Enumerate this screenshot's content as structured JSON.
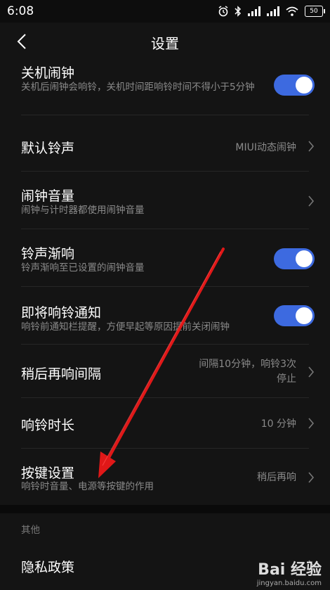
{
  "status_bar": {
    "time": "6:08",
    "battery": "50"
  },
  "header": {
    "title": "设置"
  },
  "settings": [
    {
      "label": "关机闹钟",
      "sub": "关机后闹钟会响铃，关机时间距响铃时间不得小于5分钟",
      "toggle": true
    },
    {
      "label": "默认铃声",
      "value": "MIUI动态闹钟"
    },
    {
      "label": "闹钟音量",
      "sub": "闹钟与计时器都使用闹钟音量"
    },
    {
      "label": "铃声渐响",
      "sub": "铃声渐响至已设置的闹钟音量",
      "toggle": true
    },
    {
      "label": "即将响铃通知",
      "sub": "响铃前通知栏提醒，方便早起等原因提前关闭闹钟",
      "toggle": true
    },
    {
      "label": "稍后再响间隔",
      "value_line1": "间隔10分钟，响铃3次",
      "value_line2": "停止"
    },
    {
      "label": "响铃时长",
      "value": "10 分钟"
    },
    {
      "label": "按键设置",
      "sub": "响铃时音量、电源等按键的作用",
      "value": "稍后再响"
    }
  ],
  "other_section": {
    "label": "其他",
    "privacy_label": "隐私政策"
  },
  "watermark": {
    "logo": "Bai 经验",
    "site": "jingyan.baidu.com"
  },
  "colors": {
    "background": "#141414",
    "toggle_on": "#3d6ae0",
    "annotation_arrow": "#e01818"
  }
}
